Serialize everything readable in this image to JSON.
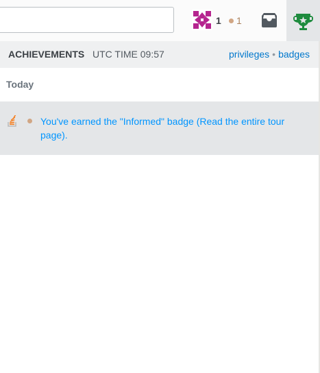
{
  "topbar": {
    "search": {
      "placeholder": "",
      "value": ""
    },
    "reputation": "1",
    "bronze_badge_count": "1",
    "inbox_icon": "inbox-icon",
    "achievements_icon": "trophy-icon"
  },
  "dropdown": {
    "title": "ACHIEVEMENTS",
    "time": "UTC TIME 09:57",
    "links": {
      "privileges": "privileges",
      "separator": "•",
      "badges": "badges"
    },
    "section": "Today",
    "items": [
      {
        "icon": "stackoverflow-icon",
        "badge_class": "bronze",
        "text": "You've earned the \"Informed\" badge (Read the entire tour page)."
      }
    ]
  },
  "colors": {
    "link": "#0077cc",
    "item_text": "#0095ff",
    "bronze": "#d1a684",
    "trophy": "#1e8b3e",
    "avatar": "#b5258f"
  }
}
